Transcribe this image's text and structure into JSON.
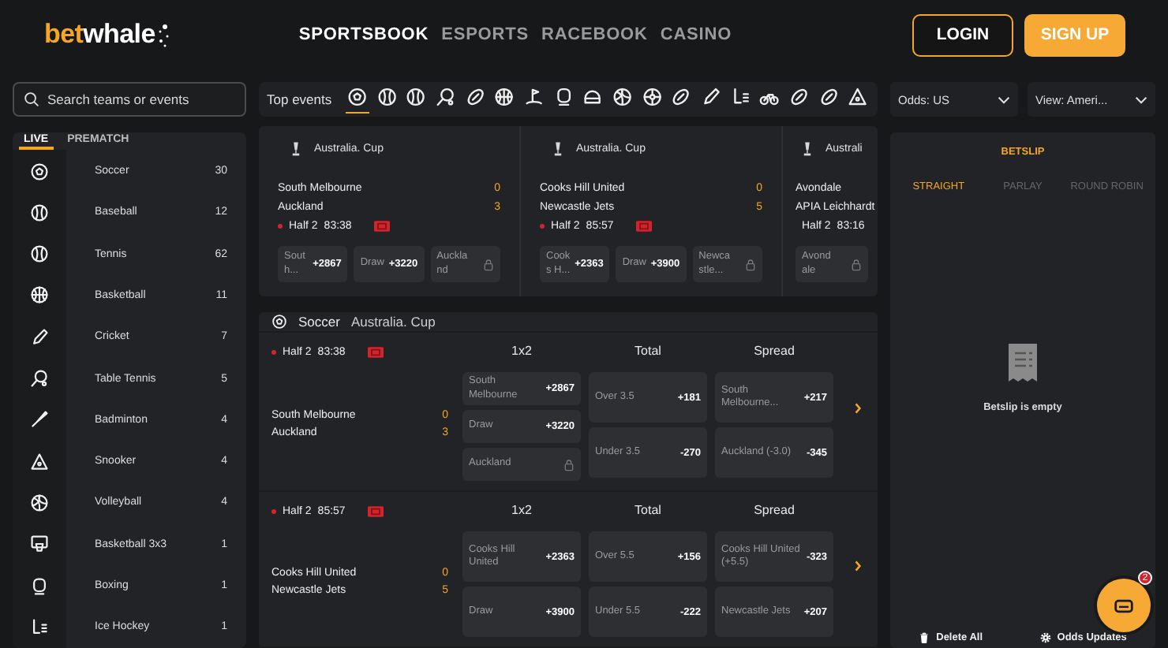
{
  "header": {
    "logo": {
      "accent": "bet",
      "rest": "whale"
    },
    "nav": [
      {
        "label": "SPORTSBOOK",
        "selected": true
      },
      {
        "label": "ESPORTS",
        "selected": false
      },
      {
        "label": "RACEBOOK",
        "selected": false
      },
      {
        "label": "CASINO",
        "selected": false
      }
    ],
    "buttons": [
      {
        "label": "LOGIN",
        "kind": "outline"
      },
      {
        "label": "SIGN UP",
        "kind": "filled"
      }
    ]
  },
  "search": {
    "placeholder": "Search teams or events"
  },
  "sports_panel": {
    "tabs": [
      {
        "label": "LIVE",
        "selected": true
      },
      {
        "label": "PREMATCH",
        "selected": false
      }
    ],
    "items": [
      {
        "name": "Soccer",
        "count": "30"
      },
      {
        "name": "Baseball",
        "count": "12"
      },
      {
        "name": "Tennis",
        "count": "62"
      },
      {
        "name": "Basketball",
        "count": "11"
      },
      {
        "name": "Cricket",
        "count": "7"
      },
      {
        "name": "Table Tennis",
        "count": "5"
      },
      {
        "name": "Badminton",
        "count": "4"
      },
      {
        "name": "Snooker",
        "count": "4"
      },
      {
        "name": "Volleyball",
        "count": "4"
      },
      {
        "name": "Basketball 3x3",
        "count": "1"
      },
      {
        "name": "Boxing",
        "count": "1"
      },
      {
        "name": "Ice Hockey",
        "count": "1"
      }
    ]
  },
  "top_events": {
    "title": "Top events",
    "sports": [
      {
        "selected": true
      },
      {
        "selected": false
      },
      {
        "selected": false
      },
      {
        "selected": false
      },
      {
        "selected": false
      },
      {
        "selected": false
      },
      {
        "selected": false
      },
      {
        "selected": false
      },
      {
        "selected": false
      },
      {
        "selected": false
      },
      {
        "selected": false
      },
      {
        "selected": false
      },
      {
        "selected": false
      },
      {
        "selected": false
      },
      {
        "selected": false
      },
      {
        "selected": false
      },
      {
        "selected": false
      },
      {
        "selected": false
      }
    ],
    "cards": [
      {
        "league": "Australia. Cup",
        "teams": [
          {
            "name": "South Melbourne",
            "score": "0"
          },
          {
            "name": "Auckland",
            "score": "3"
          }
        ],
        "period": "Half 2",
        "clock": "83:38",
        "odds": [
          {
            "label": "South...",
            "odds": "+2867",
            "locked": false
          },
          {
            "label": "Draw",
            "odds": "+3220",
            "locked": false
          },
          {
            "label": "Auckland",
            "locked": true
          }
        ]
      },
      {
        "league": "Australia. Cup",
        "teams": [
          {
            "name": "Cooks Hill United",
            "score": "0"
          },
          {
            "name": "Newcastle Jets",
            "score": "5"
          }
        ],
        "period": "Half 2",
        "clock": "85:57",
        "odds": [
          {
            "label": "Cooks H...",
            "odds": "+2363",
            "locked": false
          },
          {
            "label": "Draw",
            "odds": "+3900",
            "locked": false
          },
          {
            "label": "Newcastle...",
            "locked": true
          }
        ]
      },
      {
        "league": "Australi",
        "teams": [
          {
            "name": "Avondale"
          },
          {
            "name": "APIA Leichhardt"
          }
        ],
        "period": "Half 2",
        "clock": "83:16",
        "odds": [
          {
            "label": "Avondale",
            "locked": true
          }
        ]
      }
    ]
  },
  "markets": {
    "sport": "Soccer",
    "league": "Australia. Cup",
    "matches": [
      {
        "period": "Half 2",
        "clock": "83:38",
        "teams": [
          {
            "name": "South Melbourne",
            "score": "0"
          },
          {
            "name": "Auckland",
            "score": "3"
          }
        ],
        "columns": [
          {
            "title": "1x2",
            "cells": [
              {
                "label": "South Melbourne",
                "odds": "+2867",
                "locked": false
              },
              {
                "label": "Draw",
                "odds": "+3220",
                "locked": false
              },
              {
                "label": "Auckland",
                "locked": true
              }
            ]
          },
          {
            "title": "Total",
            "cells": [
              {
                "label": "Over 3.5",
                "odds": "+181",
                "locked": false
              },
              {
                "label": "Under 3.5",
                "odds": "-270",
                "locked": false
              }
            ]
          },
          {
            "title": "Spread",
            "cells": [
              {
                "label": "South Melbourne...",
                "odds": "+217",
                "locked": false
              },
              {
                "label": "Auckland (-3.0)",
                "odds": "-345",
                "locked": false
              }
            ]
          }
        ]
      },
      {
        "period": "Half 2",
        "clock": "85:57",
        "teams": [
          {
            "name": "Cooks Hill United",
            "score": "0"
          },
          {
            "name": "Newcastle Jets",
            "score": "5"
          }
        ],
        "columns": [
          {
            "title": "1x2",
            "cells": [
              {
                "label": "Cooks Hill United",
                "odds": "+2363",
                "locked": false
              },
              {
                "label": "Draw",
                "odds": "+3900",
                "locked": false
              }
            ]
          },
          {
            "title": "Total",
            "cells": [
              {
                "label": "Over 5.5",
                "odds": "+156",
                "locked": false
              },
              {
                "label": "Under 5.5",
                "odds": "-222",
                "locked": false
              }
            ]
          },
          {
            "title": "Spread",
            "cells": [
              {
                "label": "Cooks Hill United (+5.5)",
                "odds": "-323",
                "locked": false
              },
              {
                "label": "Newcastle Jets",
                "odds": "+207",
                "locked": false
              }
            ]
          }
        ]
      }
    ]
  },
  "settings": {
    "odds": "Odds: US",
    "view": "View: Ameri..."
  },
  "betslip": {
    "title": "BETSLIP",
    "tabs": [
      {
        "label": "STRAIGHT",
        "selected": true
      },
      {
        "label": "PARLAY",
        "selected": false
      },
      {
        "label": "ROUND ROBIN",
        "selected": false
      }
    ],
    "empty_message": "Betslip is empty",
    "actions": [
      {
        "label": "Delete All",
        "kind": "delete"
      },
      {
        "label": "Odds Updates",
        "kind": "settings"
      }
    ]
  },
  "chat": {
    "badge": "2"
  }
}
